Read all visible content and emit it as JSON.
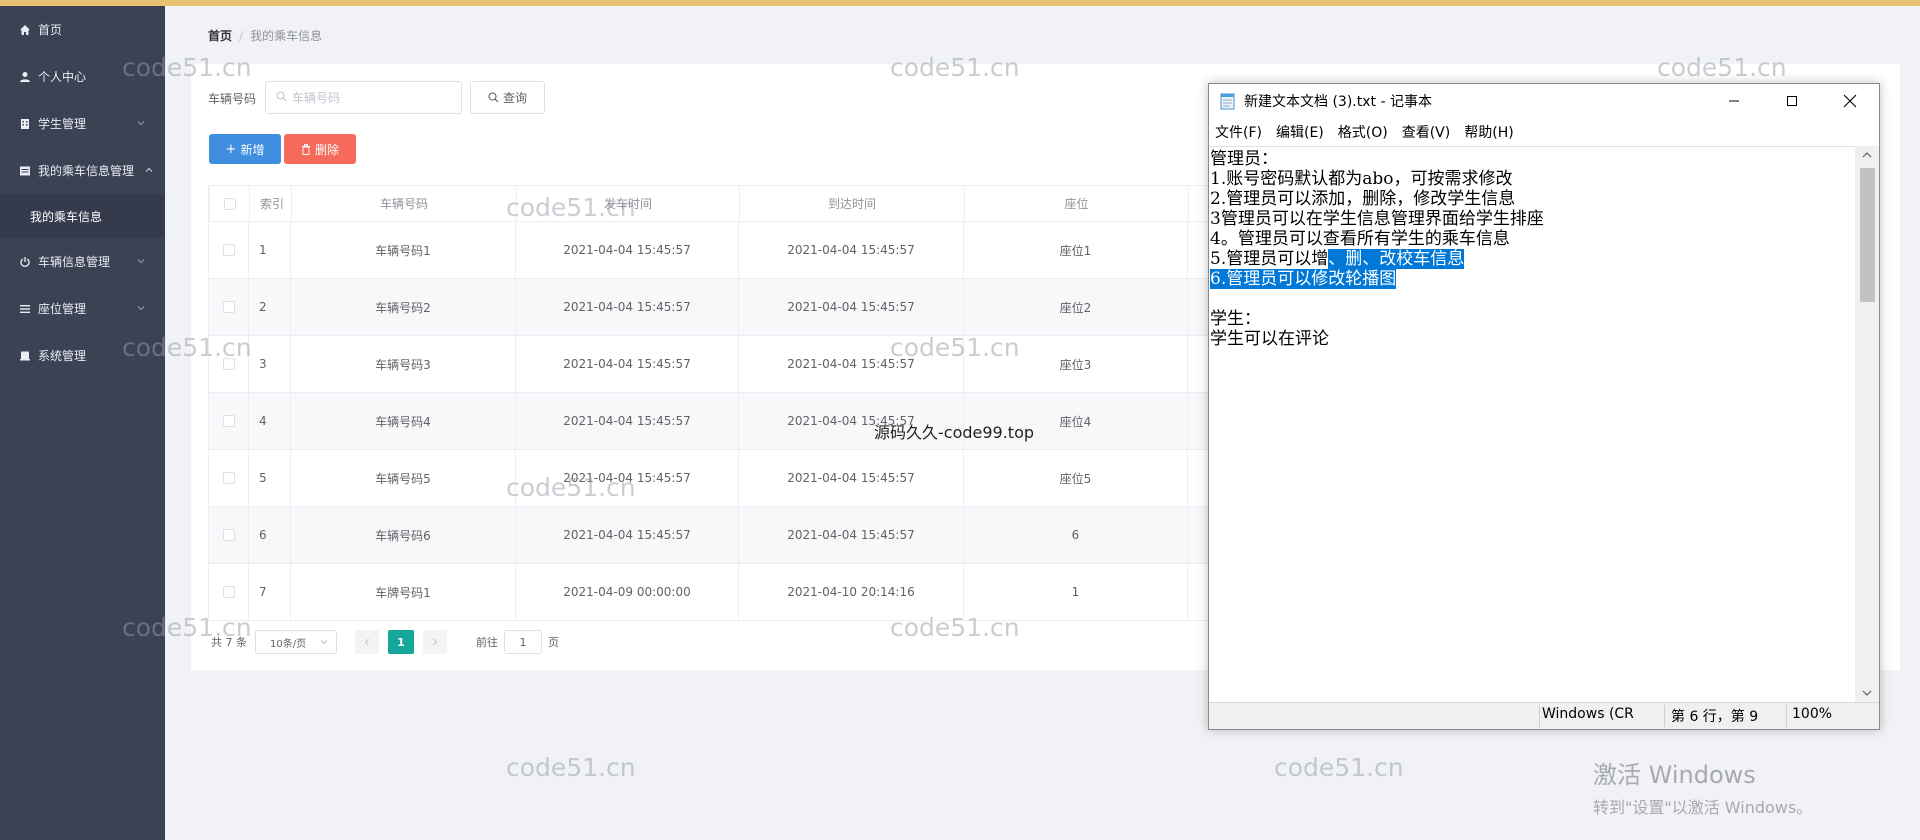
{
  "sidebar": {
    "items": [
      {
        "label": "首页",
        "icon": "home-icon"
      },
      {
        "label": "个人中心",
        "icon": "user-icon"
      },
      {
        "label": "学生管理",
        "icon": "building-icon"
      },
      {
        "label": "我的乘车信息管理",
        "icon": "list-icon"
      },
      {
        "label": "车辆信息管理",
        "icon": "power-icon"
      },
      {
        "label": "座位管理",
        "icon": "menu-icon"
      },
      {
        "label": "系统管理",
        "icon": "document-icon"
      }
    ],
    "sub_item": "我的乘车信息"
  },
  "breadcrumb": {
    "home": "首页",
    "separator": "/",
    "current": "我的乘车信息"
  },
  "search": {
    "label": "车辆号码",
    "placeholder": "车辆号码",
    "button": "查询"
  },
  "actions": {
    "add": "新增",
    "delete": "删除"
  },
  "table": {
    "headers": [
      "索引",
      "车辆号码",
      "发车时间",
      "到达时间",
      "座位"
    ],
    "rows": [
      {
        "index": "1",
        "plate": "车辆号码1",
        "depart": "2021-04-04 15:45:57",
        "arrive": "2021-04-04 15:45:57",
        "seat": "座位1"
      },
      {
        "index": "2",
        "plate": "车辆号码2",
        "depart": "2021-04-04 15:45:57",
        "arrive": "2021-04-04 15:45:57",
        "seat": "座位2"
      },
      {
        "index": "3",
        "plate": "车辆号码3",
        "depart": "2021-04-04 15:45:57",
        "arrive": "2021-04-04 15:45:57",
        "seat": "座位3"
      },
      {
        "index": "4",
        "plate": "车辆号码4",
        "depart": "2021-04-04 15:45:57",
        "arrive": "2021-04-04 15:45:57",
        "seat": "座位4"
      },
      {
        "index": "5",
        "plate": "车辆号码5",
        "depart": "2021-04-04 15:45:57",
        "arrive": "2021-04-04 15:45:57",
        "seat": "座位5"
      },
      {
        "index": "6",
        "plate": "车辆号码6",
        "depart": "2021-04-04 15:45:57",
        "arrive": "2021-04-04 15:45:57",
        "seat": "6"
      },
      {
        "index": "7",
        "plate": "车牌号码1",
        "depart": "2021-04-09 00:00:00",
        "arrive": "2021-04-10 20:14:16",
        "seat": "1"
      }
    ]
  },
  "pagination": {
    "total": "共 7 条",
    "page_size": "10条/页",
    "current_page": "1",
    "goto_label": "前往",
    "goto_value": "1",
    "page_suffix": "页"
  },
  "notepad": {
    "title": "新建文本文档 (3).txt - 记事本",
    "menu": [
      "文件(F)",
      "编辑(E)",
      "格式(O)",
      "查看(V)",
      "帮助(H)"
    ],
    "lines": [
      "管理员：",
      "1.账号密码默认都为abo，可按需求修改",
      "2.管理员可以添加，删除，修改学生信息",
      "3管理员可以在学生信息管理界面给学生排座",
      "4。管理员可以查看所有学生的乘车信息"
    ],
    "line5_plain": "5.管理员可以增",
    "line5_selected": "、删、改校车信息",
    "line6_selected": "6.管理员可以修改轮播图",
    "line7": "",
    "line8": "学生：",
    "line9": "学生可以在评论",
    "status_encoding": "Windows (CR",
    "status_position": "第 6 行，第 9",
    "status_zoom": "100%"
  },
  "watermark": "code51.cn",
  "center_watermark": "源码久久-code99.top",
  "activation": {
    "title": "激活 Windows",
    "subtitle": "转到\"设置\"以激活 Windows。"
  },
  "colors": {
    "topbar": "#e8c270",
    "sidebar": "#3b4254",
    "primary": "#3f8ee0",
    "danger": "#f56a5a",
    "pager_active": "#13a89a",
    "selection": "#0078d7"
  }
}
